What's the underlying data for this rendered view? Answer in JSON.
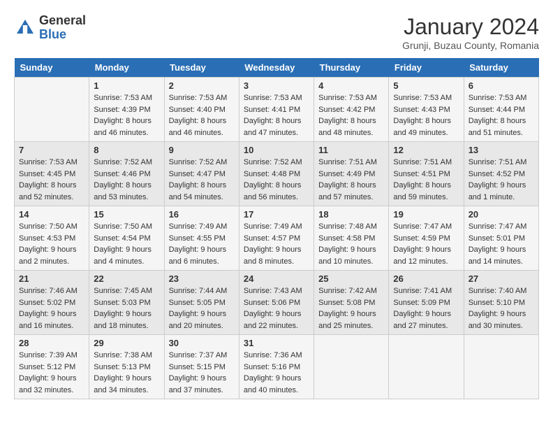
{
  "logo": {
    "general": "General",
    "blue": "Blue"
  },
  "title": "January 2024",
  "subtitle": "Grunji, Buzau County, Romania",
  "days_of_week": [
    "Sunday",
    "Monday",
    "Tuesday",
    "Wednesday",
    "Thursday",
    "Friday",
    "Saturday"
  ],
  "weeks": [
    [
      {
        "day": "",
        "sunrise": "",
        "sunset": "",
        "daylight": ""
      },
      {
        "day": "1",
        "sunrise": "Sunrise: 7:53 AM",
        "sunset": "Sunset: 4:39 PM",
        "daylight": "Daylight: 8 hours and 46 minutes."
      },
      {
        "day": "2",
        "sunrise": "Sunrise: 7:53 AM",
        "sunset": "Sunset: 4:40 PM",
        "daylight": "Daylight: 8 hours and 46 minutes."
      },
      {
        "day": "3",
        "sunrise": "Sunrise: 7:53 AM",
        "sunset": "Sunset: 4:41 PM",
        "daylight": "Daylight: 8 hours and 47 minutes."
      },
      {
        "day": "4",
        "sunrise": "Sunrise: 7:53 AM",
        "sunset": "Sunset: 4:42 PM",
        "daylight": "Daylight: 8 hours and 48 minutes."
      },
      {
        "day": "5",
        "sunrise": "Sunrise: 7:53 AM",
        "sunset": "Sunset: 4:43 PM",
        "daylight": "Daylight: 8 hours and 49 minutes."
      },
      {
        "day": "6",
        "sunrise": "Sunrise: 7:53 AM",
        "sunset": "Sunset: 4:44 PM",
        "daylight": "Daylight: 8 hours and 51 minutes."
      }
    ],
    [
      {
        "day": "7",
        "sunrise": "Sunrise: 7:53 AM",
        "sunset": "Sunset: 4:45 PM",
        "daylight": "Daylight: 8 hours and 52 minutes."
      },
      {
        "day": "8",
        "sunrise": "Sunrise: 7:52 AM",
        "sunset": "Sunset: 4:46 PM",
        "daylight": "Daylight: 8 hours and 53 minutes."
      },
      {
        "day": "9",
        "sunrise": "Sunrise: 7:52 AM",
        "sunset": "Sunset: 4:47 PM",
        "daylight": "Daylight: 8 hours and 54 minutes."
      },
      {
        "day": "10",
        "sunrise": "Sunrise: 7:52 AM",
        "sunset": "Sunset: 4:48 PM",
        "daylight": "Daylight: 8 hours and 56 minutes."
      },
      {
        "day": "11",
        "sunrise": "Sunrise: 7:51 AM",
        "sunset": "Sunset: 4:49 PM",
        "daylight": "Daylight: 8 hours and 57 minutes."
      },
      {
        "day": "12",
        "sunrise": "Sunrise: 7:51 AM",
        "sunset": "Sunset: 4:51 PM",
        "daylight": "Daylight: 8 hours and 59 minutes."
      },
      {
        "day": "13",
        "sunrise": "Sunrise: 7:51 AM",
        "sunset": "Sunset: 4:52 PM",
        "daylight": "Daylight: 9 hours and 1 minute."
      }
    ],
    [
      {
        "day": "14",
        "sunrise": "Sunrise: 7:50 AM",
        "sunset": "Sunset: 4:53 PM",
        "daylight": "Daylight: 9 hours and 2 minutes."
      },
      {
        "day": "15",
        "sunrise": "Sunrise: 7:50 AM",
        "sunset": "Sunset: 4:54 PM",
        "daylight": "Daylight: 9 hours and 4 minutes."
      },
      {
        "day": "16",
        "sunrise": "Sunrise: 7:49 AM",
        "sunset": "Sunset: 4:55 PM",
        "daylight": "Daylight: 9 hours and 6 minutes."
      },
      {
        "day": "17",
        "sunrise": "Sunrise: 7:49 AM",
        "sunset": "Sunset: 4:57 PM",
        "daylight": "Daylight: 9 hours and 8 minutes."
      },
      {
        "day": "18",
        "sunrise": "Sunrise: 7:48 AM",
        "sunset": "Sunset: 4:58 PM",
        "daylight": "Daylight: 9 hours and 10 minutes."
      },
      {
        "day": "19",
        "sunrise": "Sunrise: 7:47 AM",
        "sunset": "Sunset: 4:59 PM",
        "daylight": "Daylight: 9 hours and 12 minutes."
      },
      {
        "day": "20",
        "sunrise": "Sunrise: 7:47 AM",
        "sunset": "Sunset: 5:01 PM",
        "daylight": "Daylight: 9 hours and 14 minutes."
      }
    ],
    [
      {
        "day": "21",
        "sunrise": "Sunrise: 7:46 AM",
        "sunset": "Sunset: 5:02 PM",
        "daylight": "Daylight: 9 hours and 16 minutes."
      },
      {
        "day": "22",
        "sunrise": "Sunrise: 7:45 AM",
        "sunset": "Sunset: 5:03 PM",
        "daylight": "Daylight: 9 hours and 18 minutes."
      },
      {
        "day": "23",
        "sunrise": "Sunrise: 7:44 AM",
        "sunset": "Sunset: 5:05 PM",
        "daylight": "Daylight: 9 hours and 20 minutes."
      },
      {
        "day": "24",
        "sunrise": "Sunrise: 7:43 AM",
        "sunset": "Sunset: 5:06 PM",
        "daylight": "Daylight: 9 hours and 22 minutes."
      },
      {
        "day": "25",
        "sunrise": "Sunrise: 7:42 AM",
        "sunset": "Sunset: 5:08 PM",
        "daylight": "Daylight: 9 hours and 25 minutes."
      },
      {
        "day": "26",
        "sunrise": "Sunrise: 7:41 AM",
        "sunset": "Sunset: 5:09 PM",
        "daylight": "Daylight: 9 hours and 27 minutes."
      },
      {
        "day": "27",
        "sunrise": "Sunrise: 7:40 AM",
        "sunset": "Sunset: 5:10 PM",
        "daylight": "Daylight: 9 hours and 30 minutes."
      }
    ],
    [
      {
        "day": "28",
        "sunrise": "Sunrise: 7:39 AM",
        "sunset": "Sunset: 5:12 PM",
        "daylight": "Daylight: 9 hours and 32 minutes."
      },
      {
        "day": "29",
        "sunrise": "Sunrise: 7:38 AM",
        "sunset": "Sunset: 5:13 PM",
        "daylight": "Daylight: 9 hours and 34 minutes."
      },
      {
        "day": "30",
        "sunrise": "Sunrise: 7:37 AM",
        "sunset": "Sunset: 5:15 PM",
        "daylight": "Daylight: 9 hours and 37 minutes."
      },
      {
        "day": "31",
        "sunrise": "Sunrise: 7:36 AM",
        "sunset": "Sunset: 5:16 PM",
        "daylight": "Daylight: 9 hours and 40 minutes."
      },
      {
        "day": "",
        "sunrise": "",
        "sunset": "",
        "daylight": ""
      },
      {
        "day": "",
        "sunrise": "",
        "sunset": "",
        "daylight": ""
      },
      {
        "day": "",
        "sunrise": "",
        "sunset": "",
        "daylight": ""
      }
    ]
  ]
}
